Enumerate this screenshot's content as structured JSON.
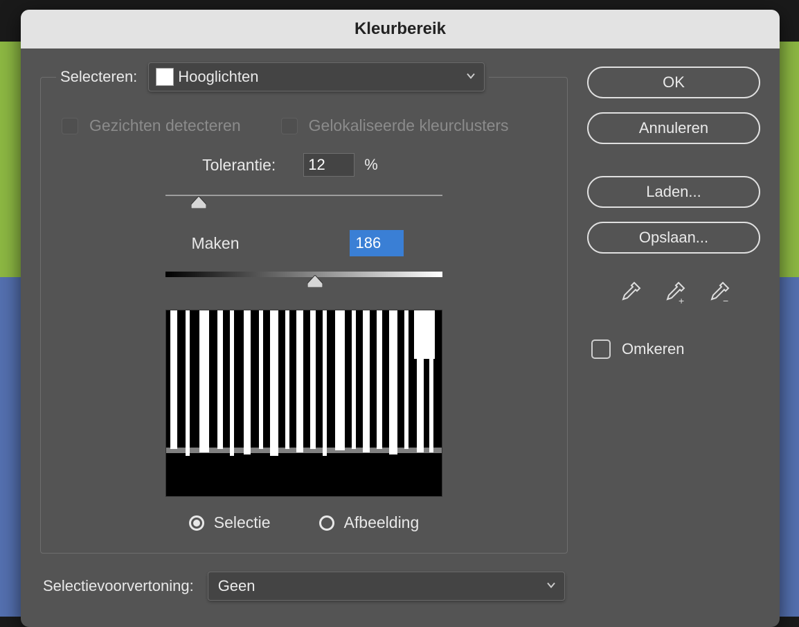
{
  "title": "Kleurbereik",
  "select_label": "Selecteren:",
  "select_value": "Hooglichten",
  "check_detect_faces": "Gezichten detecteren",
  "check_localized": "Gelokaliseerde kleurclusters",
  "tolerance_label": "Tolerantie:",
  "tolerance_value": "12",
  "tolerance_unit": "%",
  "tolerance_percent": 12,
  "range_label": "Maken",
  "range_value": "186",
  "range_percent": 54,
  "radio_selection": "Selectie",
  "radio_image": "Afbeelding",
  "preview_label": "Selectievoorvertoning:",
  "preview_value": "Geen",
  "buttons": {
    "ok": "OK",
    "cancel": "Annuleren",
    "load": "Laden...",
    "save": "Opslaan..."
  },
  "invert_label": "Omkeren"
}
